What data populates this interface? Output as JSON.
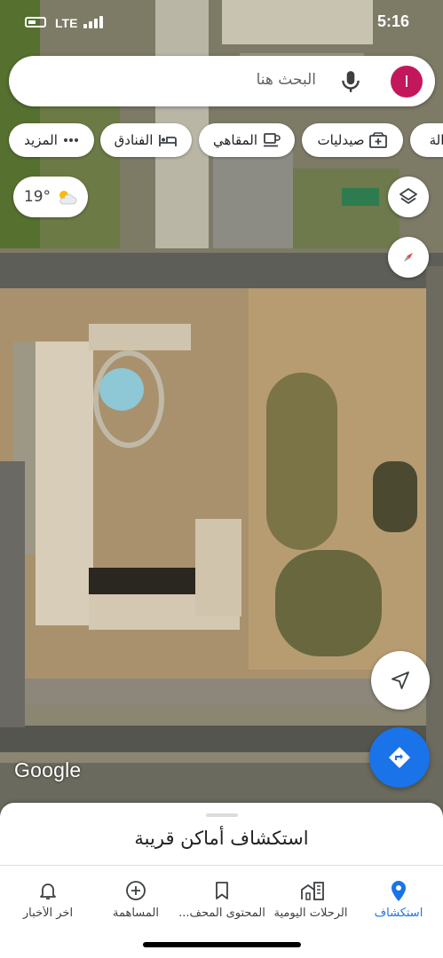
{
  "status_bar": {
    "time": "5:16",
    "network": "LTE"
  },
  "search": {
    "placeholder": "البحث هنا",
    "avatar_letter": "I"
  },
  "chips": [
    {
      "label": "صيدليات",
      "icon": "pharmacy-icon"
    },
    {
      "label": "المقاهي",
      "icon": "coffee-icon"
    },
    {
      "label": "الفنادق",
      "icon": "hotel-bed-icon"
    },
    {
      "label": "المزيد",
      "icon": "more-dots-icon"
    }
  ],
  "weather": {
    "temperature": "19°",
    "icon": "partly-cloudy-icon"
  },
  "map": {
    "attribution": "Google",
    "type": "satellite"
  },
  "sheet": {
    "title": "استكشاف أماكن قريبة"
  },
  "nav": [
    {
      "label": "استكشاف",
      "icon": "location-pin-icon",
      "active": true
    },
    {
      "label": "الرحلات اليومية",
      "icon": "commute-building-icon",
      "active": false
    },
    {
      "label": "المحتوى المحف...",
      "icon": "bookmark-icon",
      "active": false
    },
    {
      "label": "المساهمة",
      "icon": "add-circle-icon",
      "active": false
    },
    {
      "label": "آخر الأخبار",
      "icon": "bell-icon",
      "active": false
    }
  ],
  "colors": {
    "accent": "#1a73e8",
    "avatar": "#c2185b"
  }
}
